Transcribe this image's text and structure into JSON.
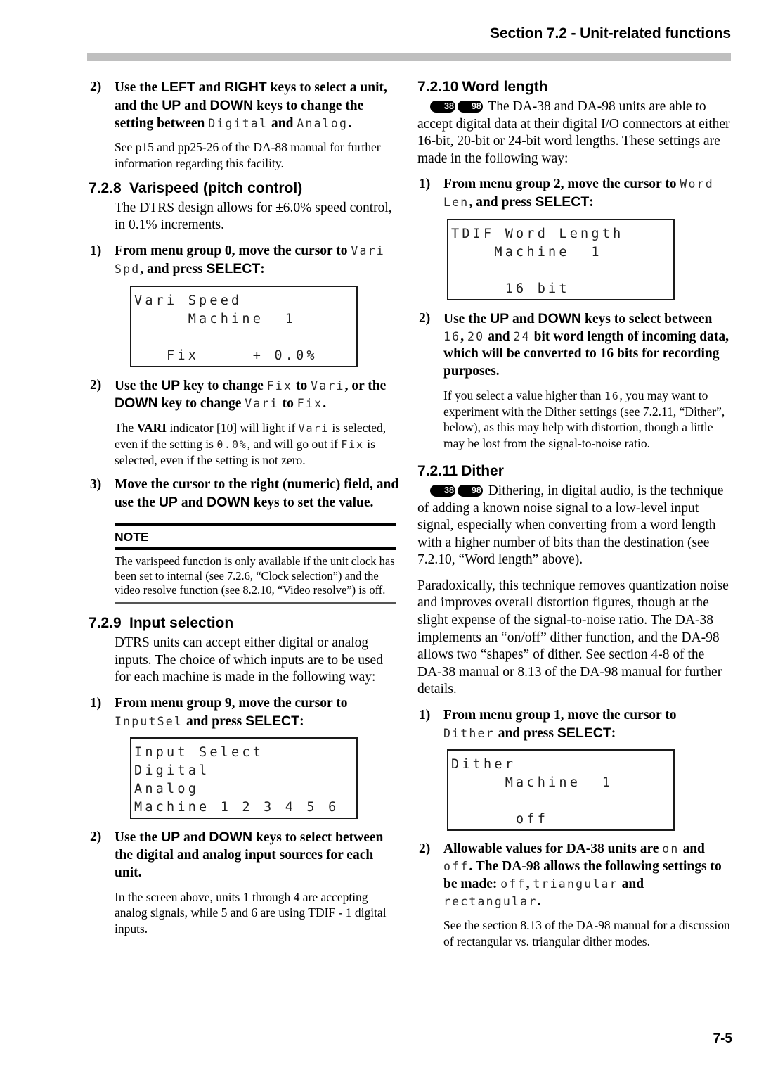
{
  "header": {
    "title": "Section 7.2 - Unit-related functions"
  },
  "footer": {
    "page_number": "7-5"
  },
  "left_column": {
    "step_2_input_setting": {
      "marker": "2)",
      "text_a": "Use the ",
      "key_left": "LEFT",
      "text_b": " and ",
      "key_right": "RIGHT",
      "text_c": " keys to select a unit, and the ",
      "key_up": "UP",
      "text_d": " and ",
      "key_down": "DOWN",
      "text_e": " keys to change the setting between ",
      "lcd_digital": "Digital",
      "text_f": " and ",
      "lcd_analog": "Analog",
      "text_g": "."
    },
    "step_2_sub": "See p15 and pp25-26 of the DA-88 manual for further information regarding this facility.",
    "section_728": {
      "number": "7.2.8",
      "title": "Varispeed (pitch control)"
    },
    "section_728_body": "The DTRS design allows for ±6.0% speed control, in 0.1% increments.",
    "step_728_1": {
      "marker": "1)",
      "text_a": "From menu group 0, move the cursor to ",
      "lcd_varispd": "Vari Spd",
      "text_b": ", and press ",
      "key_select": "SELECT",
      "text_c": ":"
    },
    "lcd_varispeed": {
      "line1": "Vari Speed",
      "line2": "     Machine  1",
      "line3": "",
      "line4": "   Fix     + 0.0%"
    },
    "step_728_2": {
      "marker": "2)",
      "text_a": "Use the ",
      "key_up": "UP",
      "text_b": " key to change ",
      "lcd_fix": "Fix",
      "text_c": " to ",
      "lcd_vari": "Vari",
      "text_d": ", or the ",
      "key_down": "DOWN",
      "text_e": " key to change ",
      "lcd_vari2": "Vari",
      "text_f": " to ",
      "lcd_fix2": "Fix",
      "text_g": "."
    },
    "step_728_2_sub": {
      "text_a": "The ",
      "bold_vari": "VARI",
      "text_b": " indicator [10] will light if ",
      "lcd_vari": "Vari",
      "text_c": " is selected, even if the setting is ",
      "lcd_zero": "0.0%",
      "text_d": ", and will go out if ",
      "lcd_fix": "Fix",
      "text_e": " is selected, even if the setting is not zero."
    },
    "step_728_3": {
      "marker": "3)",
      "text_a": "Move the cursor to the right (numeric) field, and use the ",
      "key_up": "UP",
      "text_b": " and ",
      "key_down": "DOWN",
      "text_c": " keys to set the value."
    },
    "note": {
      "label": "NOTE",
      "body": "The varispeed function is only available if the unit clock has been set to internal (see 7.2.6, “Clock selection”) and the video resolve function (see 8.2.10, “Video resolve”) is off."
    },
    "section_729": {
      "number": "7.2.9",
      "title": "Input selection"
    },
    "section_729_body": "DTRS units can accept either digital or analog inputs. The choice of which inputs are to be used for each machine is made in the following way:",
    "step_729_1": {
      "marker": "1)",
      "text_a": "From menu group 9, move the cursor to ",
      "lcd_inputsel": "InputSel",
      "text_b": " and press ",
      "key_select": "SELECT",
      "text_c": ":"
    },
    "lcd_inputselect": {
      "line1": "Input Select",
      "line2": "Digital",
      "line3": "Analog",
      "line4": "Machine 1 2 3 4 5 6"
    },
    "step_729_2": {
      "marker": "2)",
      "text_a": "Use the ",
      "key_up": "UP",
      "text_b": " and ",
      "key_down": "DOWN",
      "text_c": " keys to select between the digital and analog input sources for each unit."
    },
    "step_729_2_sub": "In the screen above, units 1 through 4 are accepting analog signals, while 5 and 6 are using TDIF - 1 digital inputs."
  },
  "right_column": {
    "section_7210": {
      "number": "7.2.10",
      "title": "Word length"
    },
    "section_7210_body": {
      "badge_38": "38",
      "badge_98": "98",
      "text": "The DA-38 and DA-98 units are able to accept digital data at their digital I/O connectors at either 16-bit, 20-bit or 24-bit word lengths. These settings are made in the following way:"
    },
    "step_7210_1": {
      "marker": "1)",
      "text_a": "From menu group 2, move the cursor to ",
      "lcd_wordlen": "Word Len",
      "text_b": ", and press ",
      "key_select": "SELECT",
      "text_c": ":"
    },
    "lcd_wordlength": {
      "line1": "TDIF Word Length",
      "line2": "    Machine  1",
      "line3": "",
      "line4": "     16 bit"
    },
    "step_7210_2": {
      "marker": "2)",
      "text_a": "Use the ",
      "key_up": "UP",
      "text_b": " and ",
      "key_down": "DOWN",
      "text_c": " keys to select between ",
      "lcd_16": "16",
      "text_d": ", ",
      "lcd_20": "20",
      "text_e": " and ",
      "lcd_24": "24",
      "text_f": " bit word length of incoming data, which will be converted to 16 bits for recording purposes."
    },
    "step_7210_2_sub": {
      "text_a": "If you select a value higher than ",
      "lcd_16": "16",
      "text_b": ", you may want to experiment with the Dither settings (see 7.2.11, “Dither”, below), as this may help with distortion, though a little may be lost from the signal-to-noise ratio."
    },
    "section_7211": {
      "number": "7.2.11",
      "title": "Dither"
    },
    "section_7211_body_1": {
      "badge_38": "38",
      "badge_98": "98",
      "text": "Dithering, in digital audio, is the technique of adding a known noise signal to a low-level input signal, especially when converting from a word length with a higher number of bits than the destination (see 7.2.10, “Word length” above)."
    },
    "section_7211_body_2": "Paradoxically, this technique removes quantization noise and improves overall distortion figures, though at the slight expense of the signal-to-noise ratio. The DA-38 implements an “on/off” dither function, and the DA-98 allows two “shapes” of dither. See section 4-8 of the DA-38 manual or 8.13 of the DA-98 manual for further details.",
    "step_7211_1": {
      "marker": "1)",
      "text_a": "From menu group 1, move the cursor to ",
      "lcd_dither": "Dither",
      "text_b": " and press ",
      "key_select": "SELECT",
      "text_c": ":"
    },
    "lcd_dither": {
      "line1": "Dither",
      "line2": "     Machine  1",
      "line3": "",
      "line4": "      off"
    },
    "step_7211_2": {
      "marker": "2)",
      "text_a": "Allowable values for DA-38 units are ",
      "lcd_on": "on",
      "text_b": " and ",
      "lcd_off": "off",
      "text_c": ". The DA-98 allows the following settings to be made: ",
      "lcd_off2": "off",
      "text_d": ", ",
      "lcd_triangular": "triangular",
      "text_e": " and ",
      "lcd_rectangular": "rectangular",
      "text_f": "."
    },
    "step_7211_2_sub": "See the section 8.13 of the DA-98 manual for a discussion of rectangular vs. triangular dither modes."
  }
}
